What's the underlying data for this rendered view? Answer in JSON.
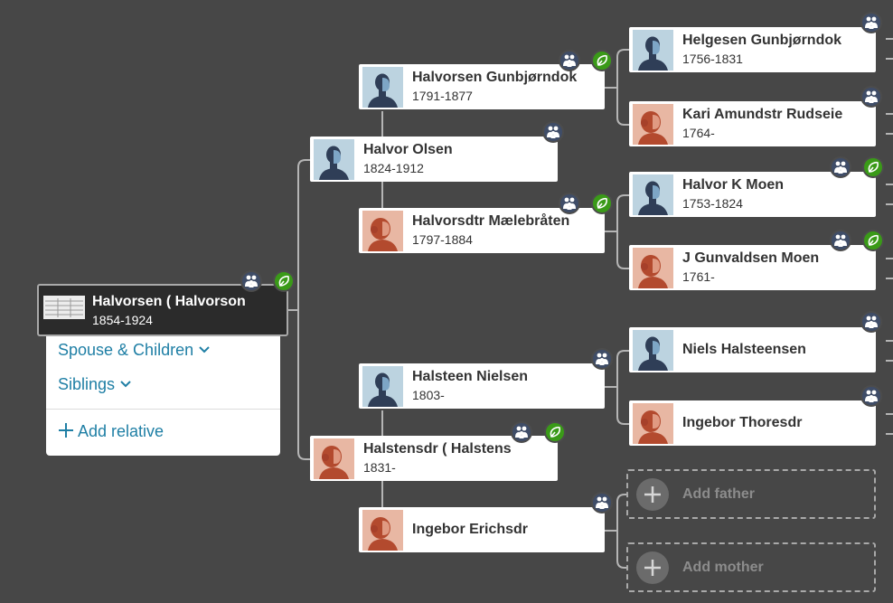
{
  "colors": {
    "background": "#474747",
    "link": "#1f7fa5",
    "family_badge": "#3f4d68",
    "hint_badge": "#3a9a18",
    "male_avatar": "#bcd3e0",
    "female_avatar": "#e8b7a3"
  },
  "root": {
    "name": "Halvorsen ( Halvorson",
    "dates": "1854-1924",
    "badge_icons": [
      "family-icon",
      "hint-leaf-icon"
    ]
  },
  "menu": {
    "spouse_children": "Spouse & Children",
    "siblings": "Siblings",
    "add_relative": "Add relative"
  },
  "people": {
    "p1": {
      "name": "Halvor Olsen",
      "dates": "1824-1912",
      "gender": "male"
    },
    "p2": {
      "name": "Halstensdr ( Halstens",
      "dates": "1831-",
      "gender": "female"
    },
    "p3": {
      "name": "Halvorsen Gunbjørndok",
      "dates": "1791-1877",
      "gender": "male"
    },
    "p4": {
      "name": "Halvorsdtr Mælebråten",
      "dates": "1797-1884",
      "gender": "female"
    },
    "p5": {
      "name": "Halsteen Nielsen",
      "dates": "1803-",
      "gender": "male"
    },
    "p6": {
      "name": "Ingebor Erichsdr",
      "dates": "",
      "gender": "female"
    },
    "p7": {
      "name": "Helgesen Gunbjørndok",
      "dates": "1756-1831",
      "gender": "male"
    },
    "p8": {
      "name": "Kari Amundstr Rudseie",
      "dates": "1764-",
      "gender": "female"
    },
    "p9": {
      "name": "Halvor K Moen",
      "dates": "1753-1824",
      "gender": "male"
    },
    "p10": {
      "name": "J Gunvaldsen Moen",
      "dates": "1761-",
      "gender": "female"
    },
    "p11": {
      "name": "Niels Halsteensen",
      "dates": "",
      "gender": "male"
    },
    "p12": {
      "name": "Ingebor Thoresdr",
      "dates": "",
      "gender": "female"
    }
  },
  "placeholders": {
    "add_father": "Add father",
    "add_mother": "Add mother"
  }
}
